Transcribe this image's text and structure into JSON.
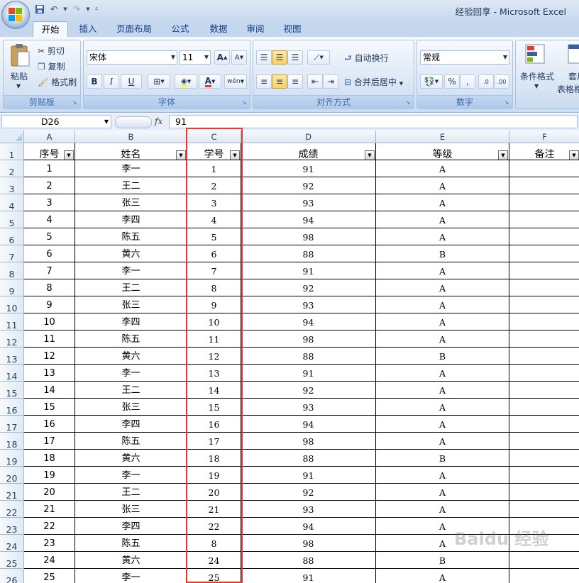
{
  "window": {
    "title": "经验回享 - Microsoft Excel"
  },
  "qat": {
    "save_icon": "save-icon",
    "undo_icon": "undo-icon",
    "redo_icon": "redo-icon"
  },
  "tabs": [
    "开始",
    "插入",
    "页面布局",
    "公式",
    "数据",
    "审阅",
    "视图"
  ],
  "ribbon": {
    "clipboard": {
      "label": "剪贴板",
      "paste": "粘贴",
      "cut": "剪切",
      "copy": "复制",
      "format_painter": "格式刷"
    },
    "font": {
      "label": "字体",
      "font_name": "宋体",
      "font_size": "11",
      "bold": "B",
      "italic": "I",
      "underline": "U",
      "grow": "A",
      "shrink": "A",
      "color_a": "A",
      "phonetic": "wén"
    },
    "alignment": {
      "label": "对齐方式",
      "wrap": "自动换行",
      "merge": "合并后居中"
    },
    "number": {
      "label": "数字",
      "format": "常规",
      "percent": "%",
      "comma": ",",
      "inc": ".0",
      "dec": ".00"
    },
    "styles": {
      "conditional": "条件格式",
      "table": "套用",
      "table2": "表格格"
    }
  },
  "formula_bar": {
    "name_box": "D26",
    "fx": "fx",
    "value": "91"
  },
  "columns": [
    "A",
    "B",
    "C",
    "D",
    "E",
    "F"
  ],
  "headers": [
    "序号",
    "姓名",
    "学号",
    "成绩",
    "等级",
    "备注"
  ],
  "rows": [
    [
      "1",
      "李一",
      "1",
      "91",
      "A",
      ""
    ],
    [
      "2",
      "王二",
      "2",
      "92",
      "A",
      ""
    ],
    [
      "3",
      "张三",
      "3",
      "93",
      "A",
      ""
    ],
    [
      "4",
      "李四",
      "4",
      "94",
      "A",
      ""
    ],
    [
      "5",
      "陈五",
      "5",
      "98",
      "A",
      ""
    ],
    [
      "6",
      "黄六",
      "6",
      "88",
      "B",
      ""
    ],
    [
      "7",
      "李一",
      "7",
      "91",
      "A",
      ""
    ],
    [
      "8",
      "王二",
      "8",
      "92",
      "A",
      ""
    ],
    [
      "9",
      "张三",
      "9",
      "93",
      "A",
      ""
    ],
    [
      "10",
      "李四",
      "10",
      "94",
      "A",
      ""
    ],
    [
      "11",
      "陈五",
      "11",
      "98",
      "A",
      ""
    ],
    [
      "12",
      "黄六",
      "12",
      "88",
      "B",
      ""
    ],
    [
      "13",
      "李一",
      "13",
      "91",
      "A",
      ""
    ],
    [
      "14",
      "王二",
      "14",
      "92",
      "A",
      ""
    ],
    [
      "15",
      "张三",
      "15",
      "93",
      "A",
      ""
    ],
    [
      "16",
      "李四",
      "16",
      "94",
      "A",
      ""
    ],
    [
      "17",
      "陈五",
      "17",
      "98",
      "A",
      ""
    ],
    [
      "18",
      "黄六",
      "18",
      "88",
      "B",
      ""
    ],
    [
      "19",
      "李一",
      "19",
      "91",
      "A",
      ""
    ],
    [
      "20",
      "王二",
      "20",
      "92",
      "A",
      ""
    ],
    [
      "21",
      "张三",
      "21",
      "93",
      "A",
      ""
    ],
    [
      "22",
      "李四",
      "22",
      "94",
      "A",
      ""
    ],
    [
      "23",
      "陈五",
      "8",
      "98",
      "A",
      ""
    ],
    [
      "24",
      "黄六",
      "24",
      "88",
      "B",
      ""
    ],
    [
      "25",
      "李一",
      "25",
      "91",
      "A",
      ""
    ]
  ],
  "row_numbers": [
    "1",
    "2",
    "3",
    "4",
    "5",
    "6",
    "7",
    "8",
    "9",
    "10",
    "11",
    "12",
    "13",
    "14",
    "15",
    "16",
    "17",
    "18",
    "19",
    "20",
    "21",
    "22",
    "23",
    "24",
    "25",
    "26"
  ],
  "watermark": "Baidu 经验",
  "colors": {
    "highlight": "#e53935",
    "ribbon": "#dde8f6"
  }
}
